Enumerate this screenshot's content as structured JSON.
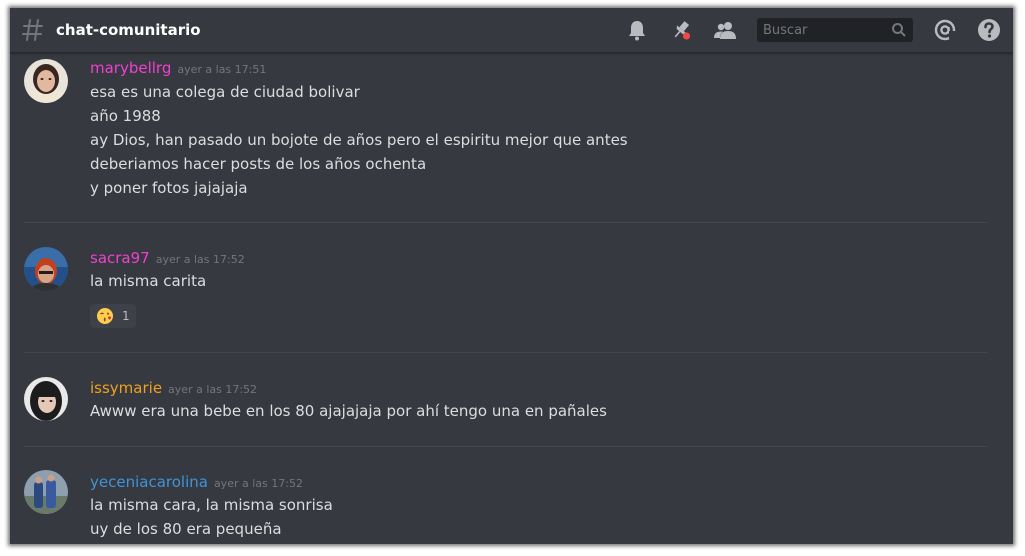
{
  "header": {
    "channel": "chat-comunitario",
    "search_placeholder": "Buscar"
  },
  "messages": [
    {
      "username": "marybellrg",
      "color": "#f040d0",
      "timestamp": "ayer a las 17:51",
      "lines": [
        "esa es una colega de ciudad bolivar",
        "año 1988",
        "ay Dios, han pasado un bojote de años pero el espiritu mejor que antes",
        "deberiamos hacer posts de los años ochenta",
        "y poner fotos jajajaja"
      ]
    },
    {
      "username": "sacra97",
      "color": "#f040d0",
      "timestamp": "ayer a las 17:52",
      "lines": [
        "la misma carita"
      ],
      "reaction": {
        "emoji": "face-blowing-kiss",
        "count": "1"
      }
    },
    {
      "username": "issymarie",
      "color": "#f0a020",
      "timestamp": "ayer a las 17:52",
      "lines": [
        "Awww era una bebe en los 80 ajajajaja por ahí tengo una en pañales"
      ]
    },
    {
      "username": "yeceniacarolina",
      "color": "#3e95d8",
      "timestamp": "ayer a las 17:52",
      "lines": [
        "la misma cara, la misma sonrisa",
        "uy de los 80 era pequeña"
      ]
    }
  ]
}
